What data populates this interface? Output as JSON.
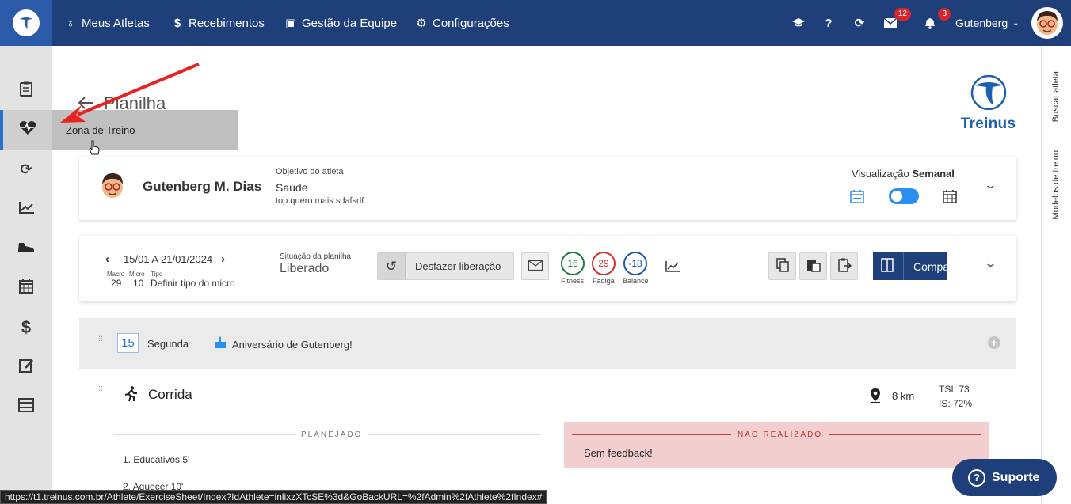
{
  "nav": {
    "items": [
      {
        "icon": "medal-icon",
        "glyph": "♁",
        "label": "Meus Atletas"
      },
      {
        "icon": "dollar-icon",
        "glyph": "$",
        "label": "Recebimentos"
      },
      {
        "icon": "id-card-icon",
        "glyph": "▣",
        "label": "Gestão da Equipe"
      },
      {
        "icon": "gears-icon",
        "glyph": "⚙",
        "label": "Configurações"
      }
    ],
    "messages_count": "12",
    "notifications_count": "3",
    "user_name": "Gutenberg"
  },
  "sidebar": {
    "tooltip": "Zona de Treino"
  },
  "right_strip": {
    "search_athlete": "Buscar atleta",
    "workout_models": "Modelos de treino"
  },
  "page": {
    "title": "Planilha",
    "brand": "Treinus"
  },
  "athlete": {
    "name": "Gutenberg M. Dias",
    "objective_label": "Objetivo do atleta",
    "objective": "Saúde",
    "objective_note": "top quero mais sdafsdf",
    "view_label": "Visualização",
    "view_mode": "Semanal"
  },
  "week": {
    "range": "15/01 A 21/01/2024",
    "macro_label": "Macro",
    "micro_label": "Micro",
    "tipo_label": "Tipo",
    "macro": "29",
    "micro": "10",
    "tipo": "Definir tipo do micro",
    "status_label": "Situação da planilha",
    "status": "Liberado",
    "undo_label": "Desfazer liberação",
    "fitness": "16",
    "fitness_label": "Fitness",
    "fadiga": "29",
    "fadiga_label": "Fadiga",
    "balance": "-18",
    "balance_label": "Balance",
    "compare_label": "Comparar"
  },
  "day": {
    "number": "15",
    "weekday": "Segunda",
    "birthday": "Aniversário de Gutenberg!"
  },
  "workout": {
    "sport": "Corrida",
    "distance": "8 km",
    "tsi": "TSI: 73",
    "is": "IS: 72%",
    "planned_header": "PLANEJADO",
    "planned_items": [
      "1. Educativos 5'",
      "2. Aquecer 10'"
    ],
    "not_done_header": "NÃO REALIZADO",
    "feedback": "Sem feedback!"
  },
  "status_url": "https://t1.treinus.com.br/Athlete/ExerciseSheet/Index?IdAthlete=inlixzXTcSE%3d&GoBackURL=%2fAdmin%2fAthlete%2fIndex#",
  "support_label": "Suporte",
  "colors": {
    "topbar": "#1f3f7a",
    "accent": "#2a6fcf",
    "fitness": "#1a7a3c",
    "fadiga": "#d0312d",
    "balance": "#2155a8",
    "annotation_arrow": "#e8231f"
  }
}
